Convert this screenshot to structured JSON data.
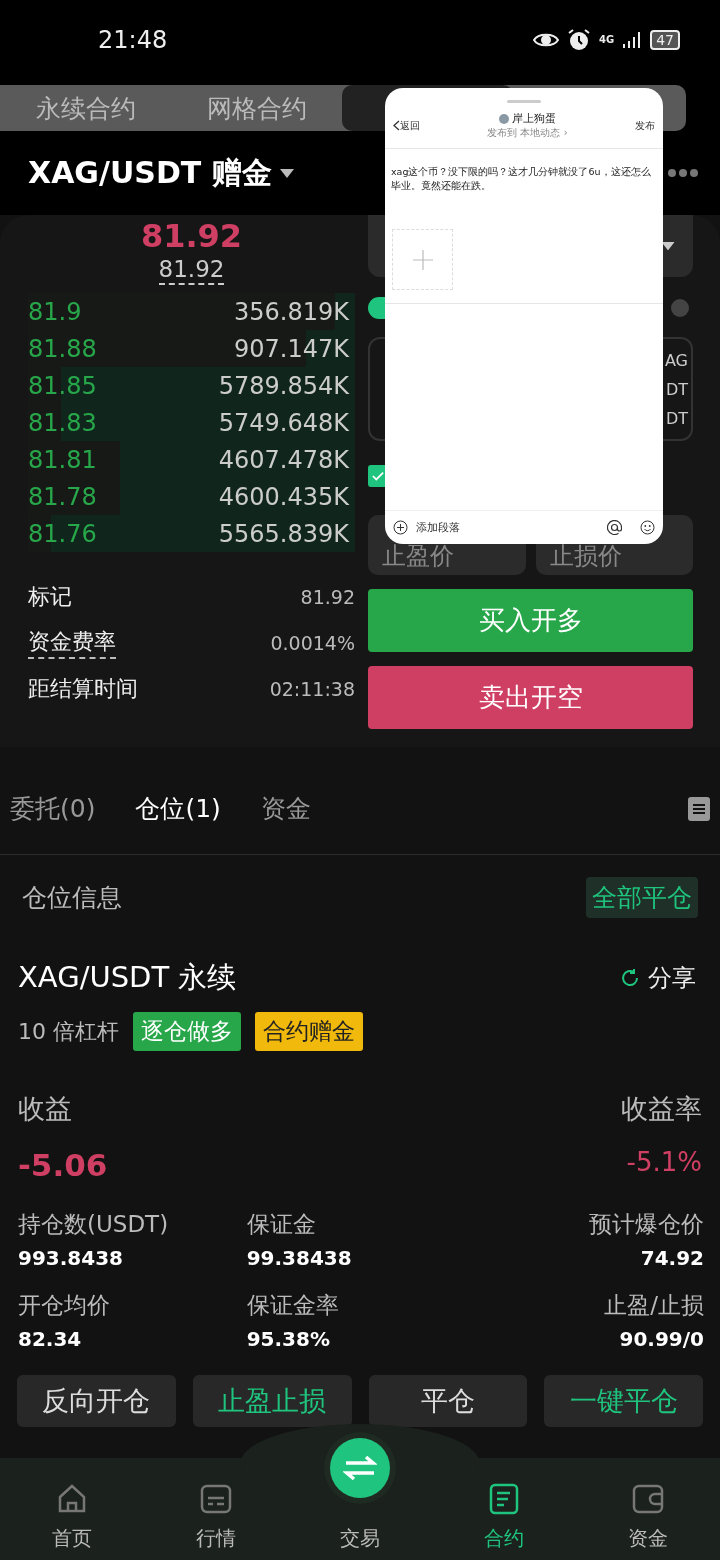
{
  "status_bar": {
    "time": "21:48",
    "network": "4G",
    "battery": "47"
  },
  "contract_tabs": [
    {
      "label": "永续合约",
      "selected": false
    },
    {
      "label": "网格合约",
      "selected": false
    },
    {
      "selected": true
    }
  ],
  "pair": {
    "symbol": "XAG/USDT 赠金"
  },
  "order_book": {
    "last_price": "81.92",
    "mark_price": "81.92",
    "rows": [
      {
        "price": "81.9",
        "amount": "356.819K",
        "level": 0.06
      },
      {
        "price": "81.88",
        "amount": "907.147K",
        "level": 0.15
      },
      {
        "price": "81.85",
        "amount": "5789.854K",
        "level": 0.9
      },
      {
        "price": "81.83",
        "amount": "5749.648K",
        "level": 0.9
      },
      {
        "price": "81.81",
        "amount": "4607.478K",
        "level": 0.72
      },
      {
        "price": "81.78",
        "amount": "4600.435K",
        "level": 0.72
      },
      {
        "price": "81.76",
        "amount": "5565.839K",
        "level": 0.93
      }
    ]
  },
  "stats": [
    {
      "label": "标记",
      "value": "81.92",
      "underlined": false
    },
    {
      "label": "资金费率",
      "value": "0.0014%",
      "underlined": true
    },
    {
      "label": "距结算时间",
      "value": "02:11:38",
      "underlined": false
    }
  ],
  "order_form": {
    "amount_units": [
      "AG",
      "DT",
      "DT"
    ],
    "tpsl_checked": true,
    "take_profit": {
      "placeholder": "止盈价"
    },
    "stop_loss": {
      "placeholder": "止损价"
    },
    "buttons": [
      {
        "label": "买入开多",
        "kind": "buy"
      },
      {
        "label": "卖出开空",
        "kind": "sell"
      }
    ]
  },
  "position_tabs": [
    {
      "label": "委托(0)",
      "selected": false
    },
    {
      "label": "仓位(1)",
      "selected": true
    },
    {
      "label": "资金",
      "selected": false
    }
  ],
  "positions_header": {
    "title": "仓位信息",
    "action": "全部平仓"
  },
  "position": {
    "symbol": "XAG/USDT 永续",
    "share": "分享",
    "leverage": "10 倍杠杆",
    "tags": [
      {
        "label": "逐仓做多",
        "color": "#27a74a"
      },
      {
        "label": "合约赠金",
        "color": "#f0b90b"
      }
    ],
    "pnl_label": "收益",
    "pnl": "-5.06",
    "roe_label": "收益率",
    "roe": "-5.1%",
    "fields": [
      {
        "label": "持仓数(USDT)",
        "value": "993.8438"
      },
      {
        "label": "保证金",
        "value": "99.38438"
      },
      {
        "label": "预计爆仓价",
        "value": "74.92"
      },
      {
        "label": "开仓均价",
        "value": "82.34"
      },
      {
        "label": "保证金率",
        "value": "95.38%"
      },
      {
        "label": "止盈/止损",
        "value": "90.99/0"
      }
    ],
    "actions": [
      {
        "label": "反向开仓",
        "kind": "plain"
      },
      {
        "label": "止盈止损",
        "kind": "accent"
      },
      {
        "label": "平仓",
        "kind": "plain"
      },
      {
        "label": "一键平仓",
        "kind": "accent"
      }
    ]
  },
  "bottom_nav": [
    {
      "label": "首页",
      "selected": false
    },
    {
      "label": "行情",
      "selected": false
    },
    {
      "label": "交易",
      "selected": false
    },
    {
      "label": "合约",
      "selected": true
    },
    {
      "label": "资金",
      "selected": false
    }
  ],
  "overlay": {
    "back": "返回",
    "author": "岸上狗蛋",
    "subtitle": "发布到 本地动态 ›",
    "publish": "发布",
    "text": "xag这个币？没下限的吗？这才几分钟就没了6u，这还怎么毕业。竟然还能在跌。",
    "footer_action": "添加段落"
  }
}
